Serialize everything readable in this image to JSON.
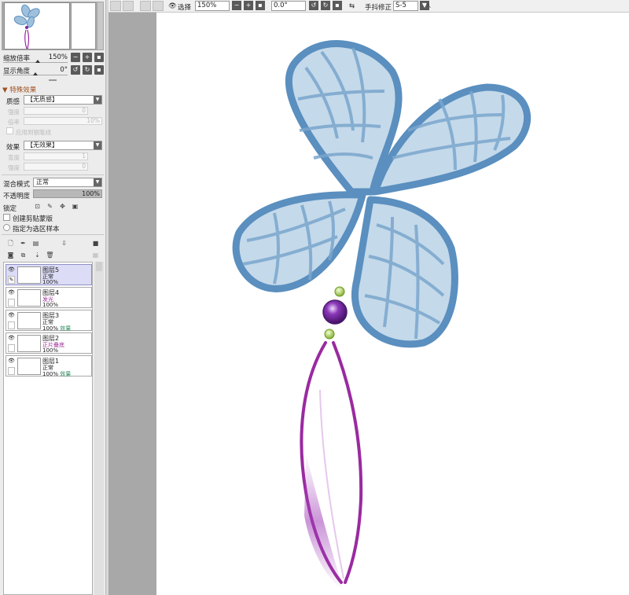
{
  "navigator": {
    "zoom_label": "缩放倍率",
    "zoom_value": "150%",
    "angle_label": "显示角度",
    "angle_value": "0°"
  },
  "effects": {
    "section_title": "特殊效果",
    "texture_label": "质感",
    "texture_value": "【无质感】",
    "texture_strength_label": "强度",
    "texture_strength_value": "0",
    "texture_scale_label": "倍率",
    "texture_scale_value": "10%",
    "brush_texture_label": "应用到钢笔线",
    "effect_label": "效果",
    "effect_value": "【无效果】",
    "effect_width_label": "宽度",
    "effect_width_value": "1",
    "effect_strength_label": "强度",
    "effect_strength_value": "0"
  },
  "layer_props": {
    "blend_label": "混合模式",
    "blend_value": "正常",
    "opacity_label": "不透明度",
    "opacity_value": "100%",
    "lock_label": "锁定",
    "clipping_label": "创建剪贴蒙版",
    "selection_source_label": "指定为选区样本"
  },
  "layers": [
    {
      "name": "图层5",
      "mode": "正常",
      "opacity": "100%",
      "fx": "",
      "active": true
    },
    {
      "name": "图层4",
      "mode": "发光",
      "opacity": "100%",
      "fx": "",
      "active": false
    },
    {
      "name": "图层3",
      "mode": "正常",
      "opacity": "100%",
      "fx": "效果",
      "active": false
    },
    {
      "name": "图层2",
      "mode": "正片叠底",
      "opacity": "100%",
      "fx": "",
      "active": false
    },
    {
      "name": "图层1",
      "mode": "正常",
      "opacity": "100%",
      "fx": "效果",
      "active": false
    }
  ],
  "toolbar": {
    "select_label": "选择",
    "zoom_value": "150%",
    "rotation_value": "0.0°",
    "stabilizer_label": "手抖修正",
    "stabilizer_value": "S-5"
  },
  "colors": {
    "petal_blue": "#5a8fbf",
    "stem_purple": "#9a2aa0",
    "bead_green": "#9ec83c"
  }
}
